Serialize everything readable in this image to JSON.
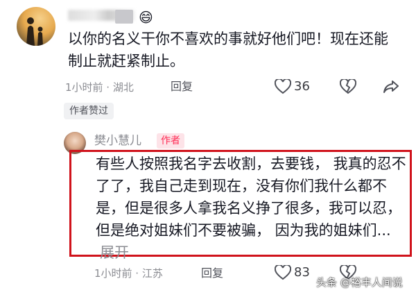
{
  "comment1": {
    "username": "",
    "text": "以你的名义干你不喜欢的事就好他们吧！现在还能制止就赶紧制止。",
    "time_location": "1小时前 · 湖北",
    "reply_label": "回复",
    "like_count": "36",
    "author_liked_tag": "作者赞过"
  },
  "comment2": {
    "username": "樊小慧儿",
    "author_tag": "作者",
    "text": "有些人按照我名字去收割，去要钱， 我真的忍不了了，我自己走到现在，没有你们我什么都不是，但是很多人拿我名义挣了很多，我可以忍，但是绝对姐妹们不要被骗， 因为我的姐妹们...",
    "expand_label": "展开",
    "time_location": "1小时前 · 江苏",
    "reply_label": "回复",
    "like_count": "83"
  },
  "watermark": "头条 @裕丰人间说",
  "colors": {
    "highlight_box": "#d0121b",
    "author_tag_bg": "#fde3e8",
    "author_tag_text": "#fe2c55",
    "meta_text": "#8a8b91"
  },
  "icons": [
    "like-icon",
    "dislike-icon",
    "share-icon"
  ]
}
